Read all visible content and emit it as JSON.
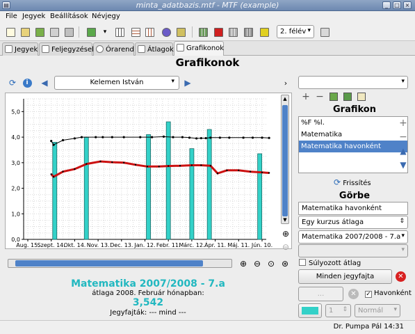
{
  "window": {
    "title": "minta_adatbazis.mtf - MTF (example)"
  },
  "menu": [
    "File",
    "Jegyek",
    "Beállítások",
    "Névjegy"
  ],
  "toolbar": {
    "semester": "2. félév"
  },
  "tabs": [
    "Jegyek",
    "Feljegyzések",
    "Órarend",
    "Átlagok",
    "Grafikonok"
  ],
  "page_title": "Grafikonok",
  "student": "Kelemen István",
  "chart_data": {
    "type": "line",
    "categories": [
      "Aug. 15.",
      "Szept. 14.",
      "Okt. 14.",
      "Nov. 13.",
      "Dec. 13.",
      "Jan. 12.",
      "Febr. 11.",
      "Márc. 12.",
      "Ápr. 11.",
      "Máj. 11.",
      "Jún. 10."
    ],
    "ylim": [
      0,
      5.5
    ],
    "yticks": [
      "0,0",
      "1,0",
      "2,0",
      "3,0",
      "4,0",
      "5,0"
    ],
    "grid": true,
    "bars": {
      "x": [
        1.15,
        2.5,
        5.15,
        6.0,
        7.0,
        7.75,
        9.9
      ],
      "values": [
        3.8,
        4.0,
        4.1,
        4.6,
        3.55,
        4.3,
        3.35
      ]
    },
    "series": [
      {
        "x": [
          1.0,
          1.1,
          1.5,
          2.0,
          2.3,
          2.9,
          3.2,
          3.6,
          4.1,
          4.8,
          5.3,
          5.8,
          6.2,
          6.6,
          6.9,
          7.2,
          7.4,
          7.6,
          7.8,
          8.2,
          8.6,
          9.2,
          9.6,
          10.0,
          10.3
        ],
        "values": [
          3.85,
          3.7,
          3.88,
          3.95,
          4.0,
          4.0,
          4.0,
          4.0,
          4.0,
          4.0,
          4.0,
          4.02,
          4.0,
          4.0,
          3.98,
          3.95,
          3.96,
          3.96,
          3.98,
          3.98,
          3.98,
          3.98,
          3.98,
          3.98,
          3.97
        ]
      },
      {
        "x": [
          1.0,
          1.1,
          1.5,
          2.0,
          2.5,
          3.1,
          3.6,
          4.1,
          4.6,
          5.1,
          5.6,
          6.0,
          6.5,
          7.0,
          7.4,
          7.8,
          8.1,
          8.5,
          9.0,
          9.5,
          10.0,
          10.3
        ],
        "values": [
          2.55,
          2.45,
          2.65,
          2.75,
          2.95,
          3.05,
          3.02,
          3.0,
          2.92,
          2.85,
          2.85,
          2.87,
          2.88,
          2.9,
          2.9,
          2.88,
          2.58,
          2.7,
          2.7,
          2.65,
          2.62,
          2.6
        ]
      }
    ],
    "colors": {
      "bars": "#33d1c8",
      "series0": "#000000",
      "series1": "#cc1111"
    }
  },
  "info": {
    "title": "Matematika 2007/2008 - 7.a",
    "subtitle": "átlaga 2008. Február hónapban:",
    "value": "3,542",
    "grades": "Jegyfajták: --- mind ---"
  },
  "side": {
    "grafikon_title": "Grafikon",
    "list": [
      "%F %l.",
      "Matematika",
      "Matematika havonként"
    ],
    "refresh_label": "Frissítés",
    "gorbe_title": "Görbe",
    "curve_name": "Matematika havonként",
    "curve_type": "Egy kurzus átlaga",
    "course": "Matematika 2007/2008 - 7.a",
    "weighted_label": "Súlyozott átlag",
    "all_grades_btn": "Minden jegyfajta",
    "ellipsis_btn": "...",
    "monthly_label": "Havonként",
    "linewidth": "1",
    "style": "Normál"
  },
  "status": "Dr. Pumpa Pál  14:31"
}
